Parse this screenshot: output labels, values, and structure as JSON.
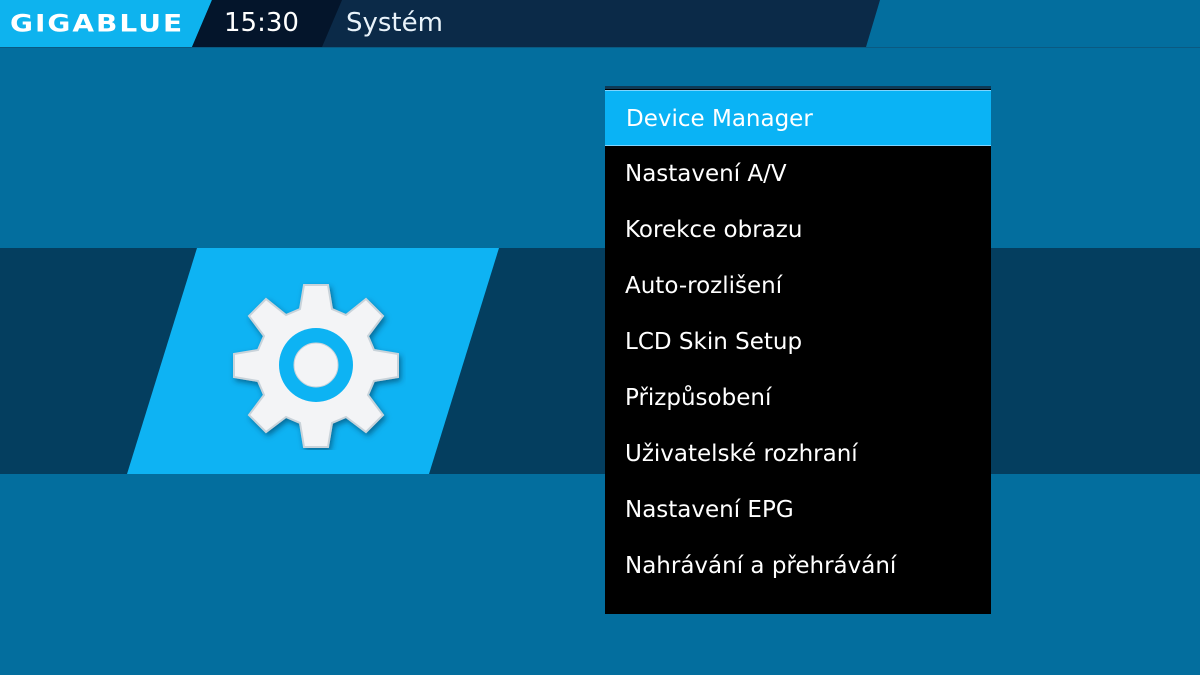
{
  "header": {
    "logo_text": "GIGABLUE",
    "time": "15:30",
    "title": "Systém",
    "logo_color": "#0eb3ee",
    "bar_color": "#0b2a48"
  },
  "icon_panel": {
    "icon": "gear-icon",
    "accent_color": "#0eb3f3"
  },
  "menu": {
    "selected_index": 0,
    "highlight_color": "#0ab3f5",
    "items": [
      {
        "label": "Device Manager"
      },
      {
        "label": "Nastavení A/V"
      },
      {
        "label": "Korekce obrazu"
      },
      {
        "label": "Auto-rozlišení"
      },
      {
        "label": "LCD Skin Setup"
      },
      {
        "label": "Přizpůsobení"
      },
      {
        "label": "Uživatelské rozhraní"
      },
      {
        "label": "Nastavení EPG"
      },
      {
        "label": "Nahrávání a přehrávání"
      }
    ]
  }
}
